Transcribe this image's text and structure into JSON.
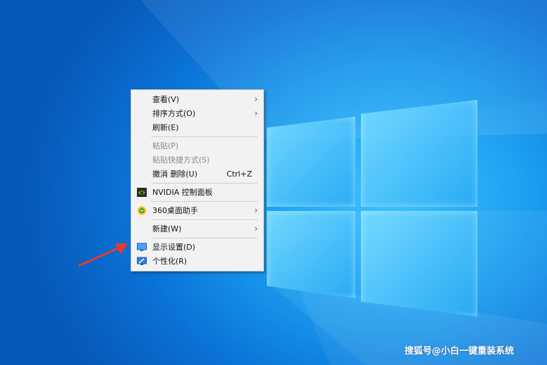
{
  "context_menu": {
    "items": [
      {
        "label": "查看(V)",
        "shortcut": "",
        "has_submenu": true,
        "disabled": false
      },
      {
        "label": "排序方式(O)",
        "shortcut": "",
        "has_submenu": true,
        "disabled": false
      },
      {
        "label": "刷新(E)",
        "shortcut": "",
        "has_submenu": false,
        "disabled": false
      },
      {
        "label": "粘贴(P)",
        "shortcut": "",
        "has_submenu": false,
        "disabled": true
      },
      {
        "label": "粘贴快捷方式(S)",
        "shortcut": "",
        "has_submenu": false,
        "disabled": true
      },
      {
        "label": "撤消 删除(U)",
        "shortcut": "Ctrl+Z",
        "has_submenu": false,
        "disabled": false
      },
      {
        "label": "NVIDIA 控制面板",
        "shortcut": "",
        "has_submenu": false,
        "disabled": false,
        "icon": "nvidia-icon"
      },
      {
        "label": "360桌面助手",
        "shortcut": "",
        "has_submenu": true,
        "disabled": false,
        "icon": "360-icon"
      },
      {
        "label": "新建(W)",
        "shortcut": "",
        "has_submenu": true,
        "disabled": false
      },
      {
        "label": "显示设置(D)",
        "shortcut": "",
        "has_submenu": false,
        "disabled": false,
        "icon": "display-icon"
      },
      {
        "label": "个性化(R)",
        "shortcut": "",
        "has_submenu": false,
        "disabled": false,
        "icon": "personalize-icon"
      }
    ],
    "submenu_glyph": "›"
  },
  "watermark": "搜狐号@小白一键重装系统",
  "colors": {
    "menu_bg": "#f2f2f2",
    "desktop_blue": "#0a72d6",
    "annotation_arrow": "#e53935"
  }
}
